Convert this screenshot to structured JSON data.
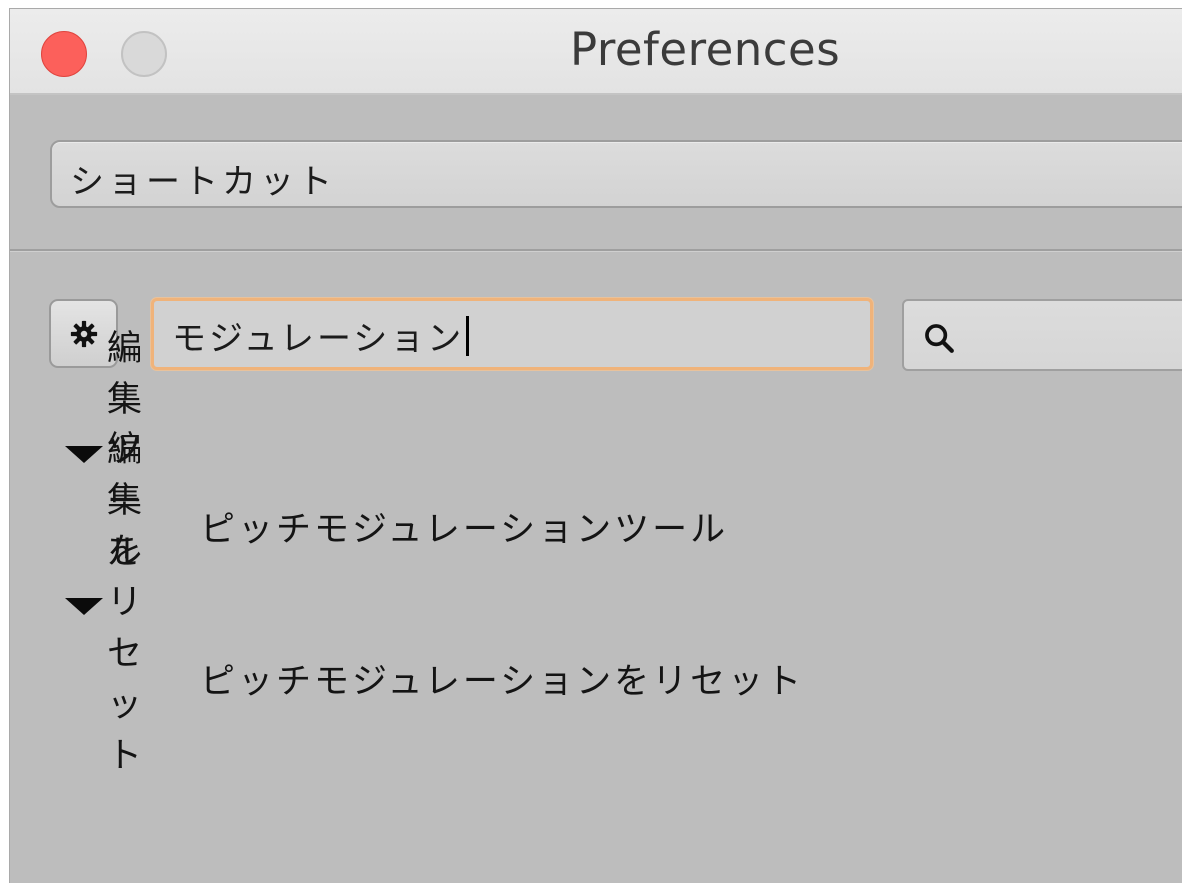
{
  "window": {
    "title": "Preferences"
  },
  "category_popup": {
    "selected": "ショートカット"
  },
  "filter": {
    "value": "モジュレーション"
  },
  "search": {
    "icon": "magnifier-icon"
  },
  "gear": {
    "icon": "gear-icon"
  },
  "tree": {
    "groups": [
      {
        "label": "編集ツール",
        "expanded": true,
        "items": [
          {
            "label": "ピッチモジュレーションツール"
          }
        ]
      },
      {
        "label": "編集をリセット",
        "expanded": true,
        "items": [
          {
            "label": "ピッチモジュレーションをリセット"
          }
        ]
      }
    ]
  },
  "colors": {
    "window_background": "#bdbdbd",
    "close_button": "#fc605b",
    "focus_ring": "#f0b37a"
  }
}
